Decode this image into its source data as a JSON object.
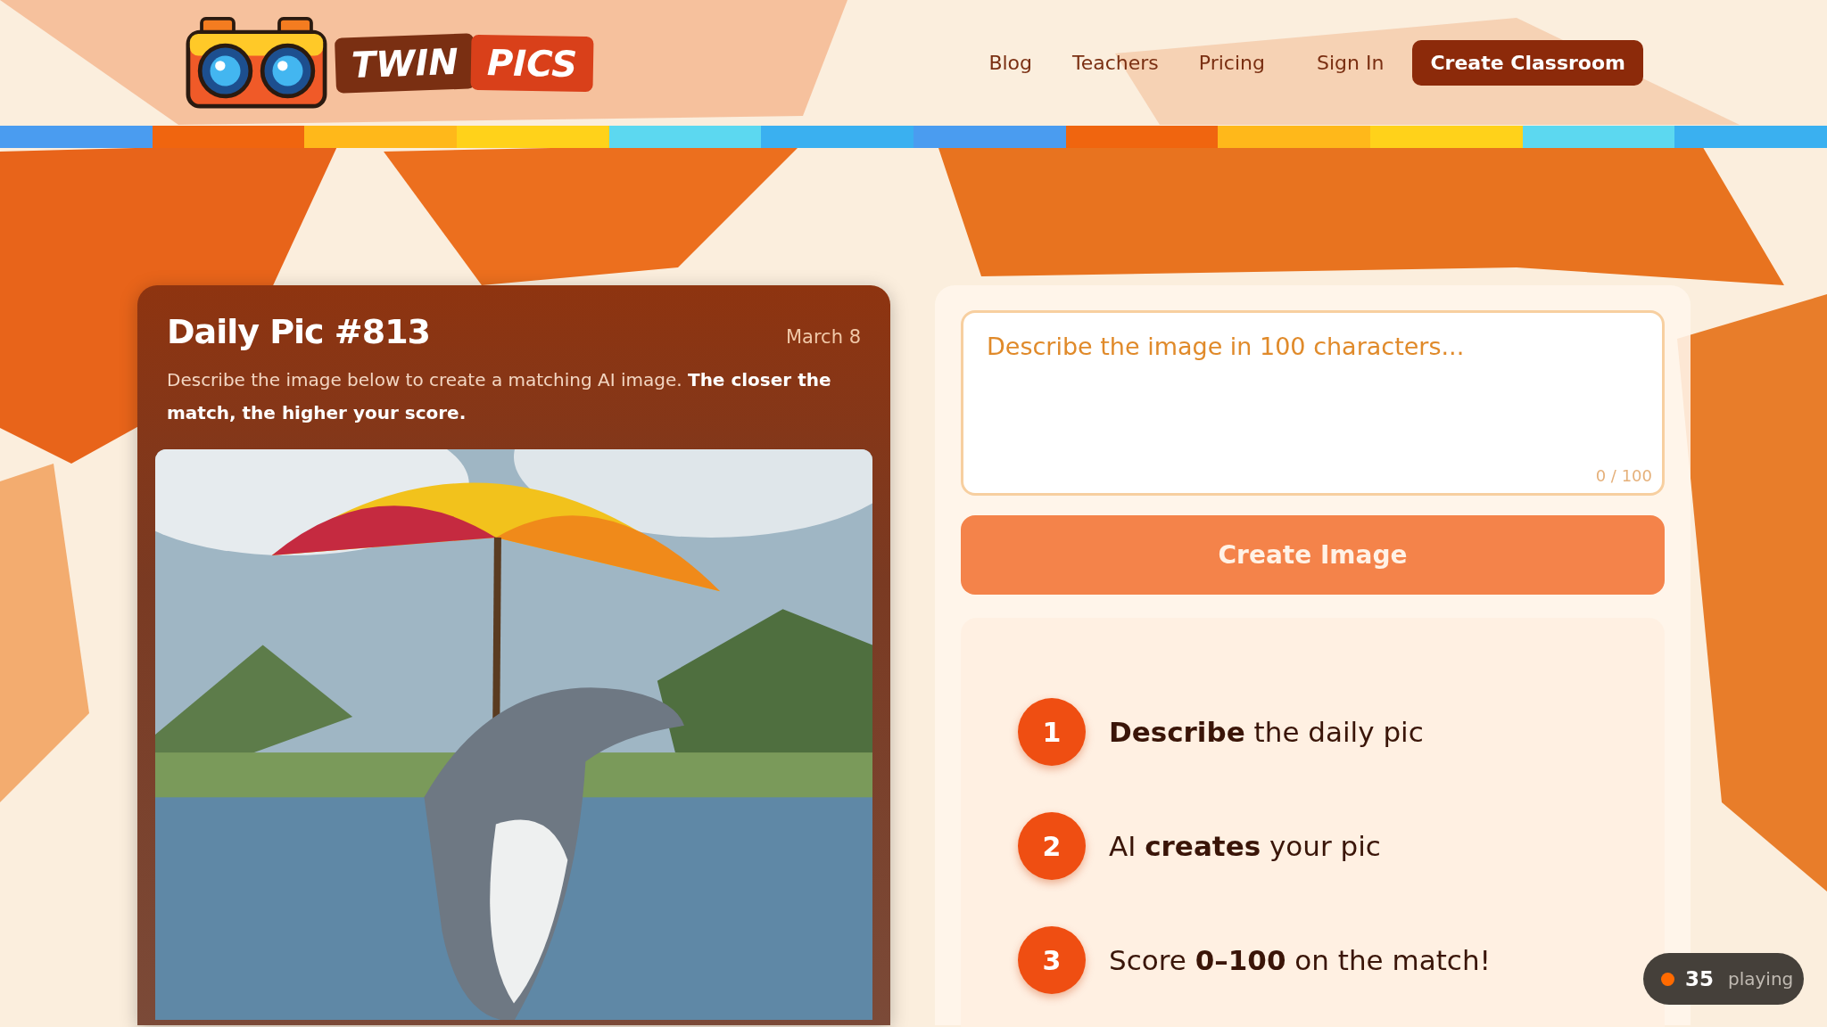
{
  "logo": {
    "words": [
      "TWIN",
      "PICS"
    ]
  },
  "nav": {
    "links": [
      "Blog",
      "Teachers",
      "Pricing",
      "Sign In"
    ],
    "cta": "Create Classroom"
  },
  "daily_pic": {
    "title": "Daily Pic #813",
    "date": "March 8",
    "description": "Describe the image below to create a matching AI image. **The closer the match, the higher your score.**"
  },
  "prompt": {
    "placeholder": "Describe the image in 100 characters...",
    "counter": "0 / 100",
    "button": "Create Image"
  },
  "steps": [
    {
      "number": "1",
      "text": "**Describe** the daily pic"
    },
    {
      "number": "2",
      "text": "AI **creates** your pic"
    },
    {
      "number": "3",
      "text": "Score **0–100** on the match!"
    }
  ],
  "players": {
    "count": "35",
    "label": "playing"
  }
}
